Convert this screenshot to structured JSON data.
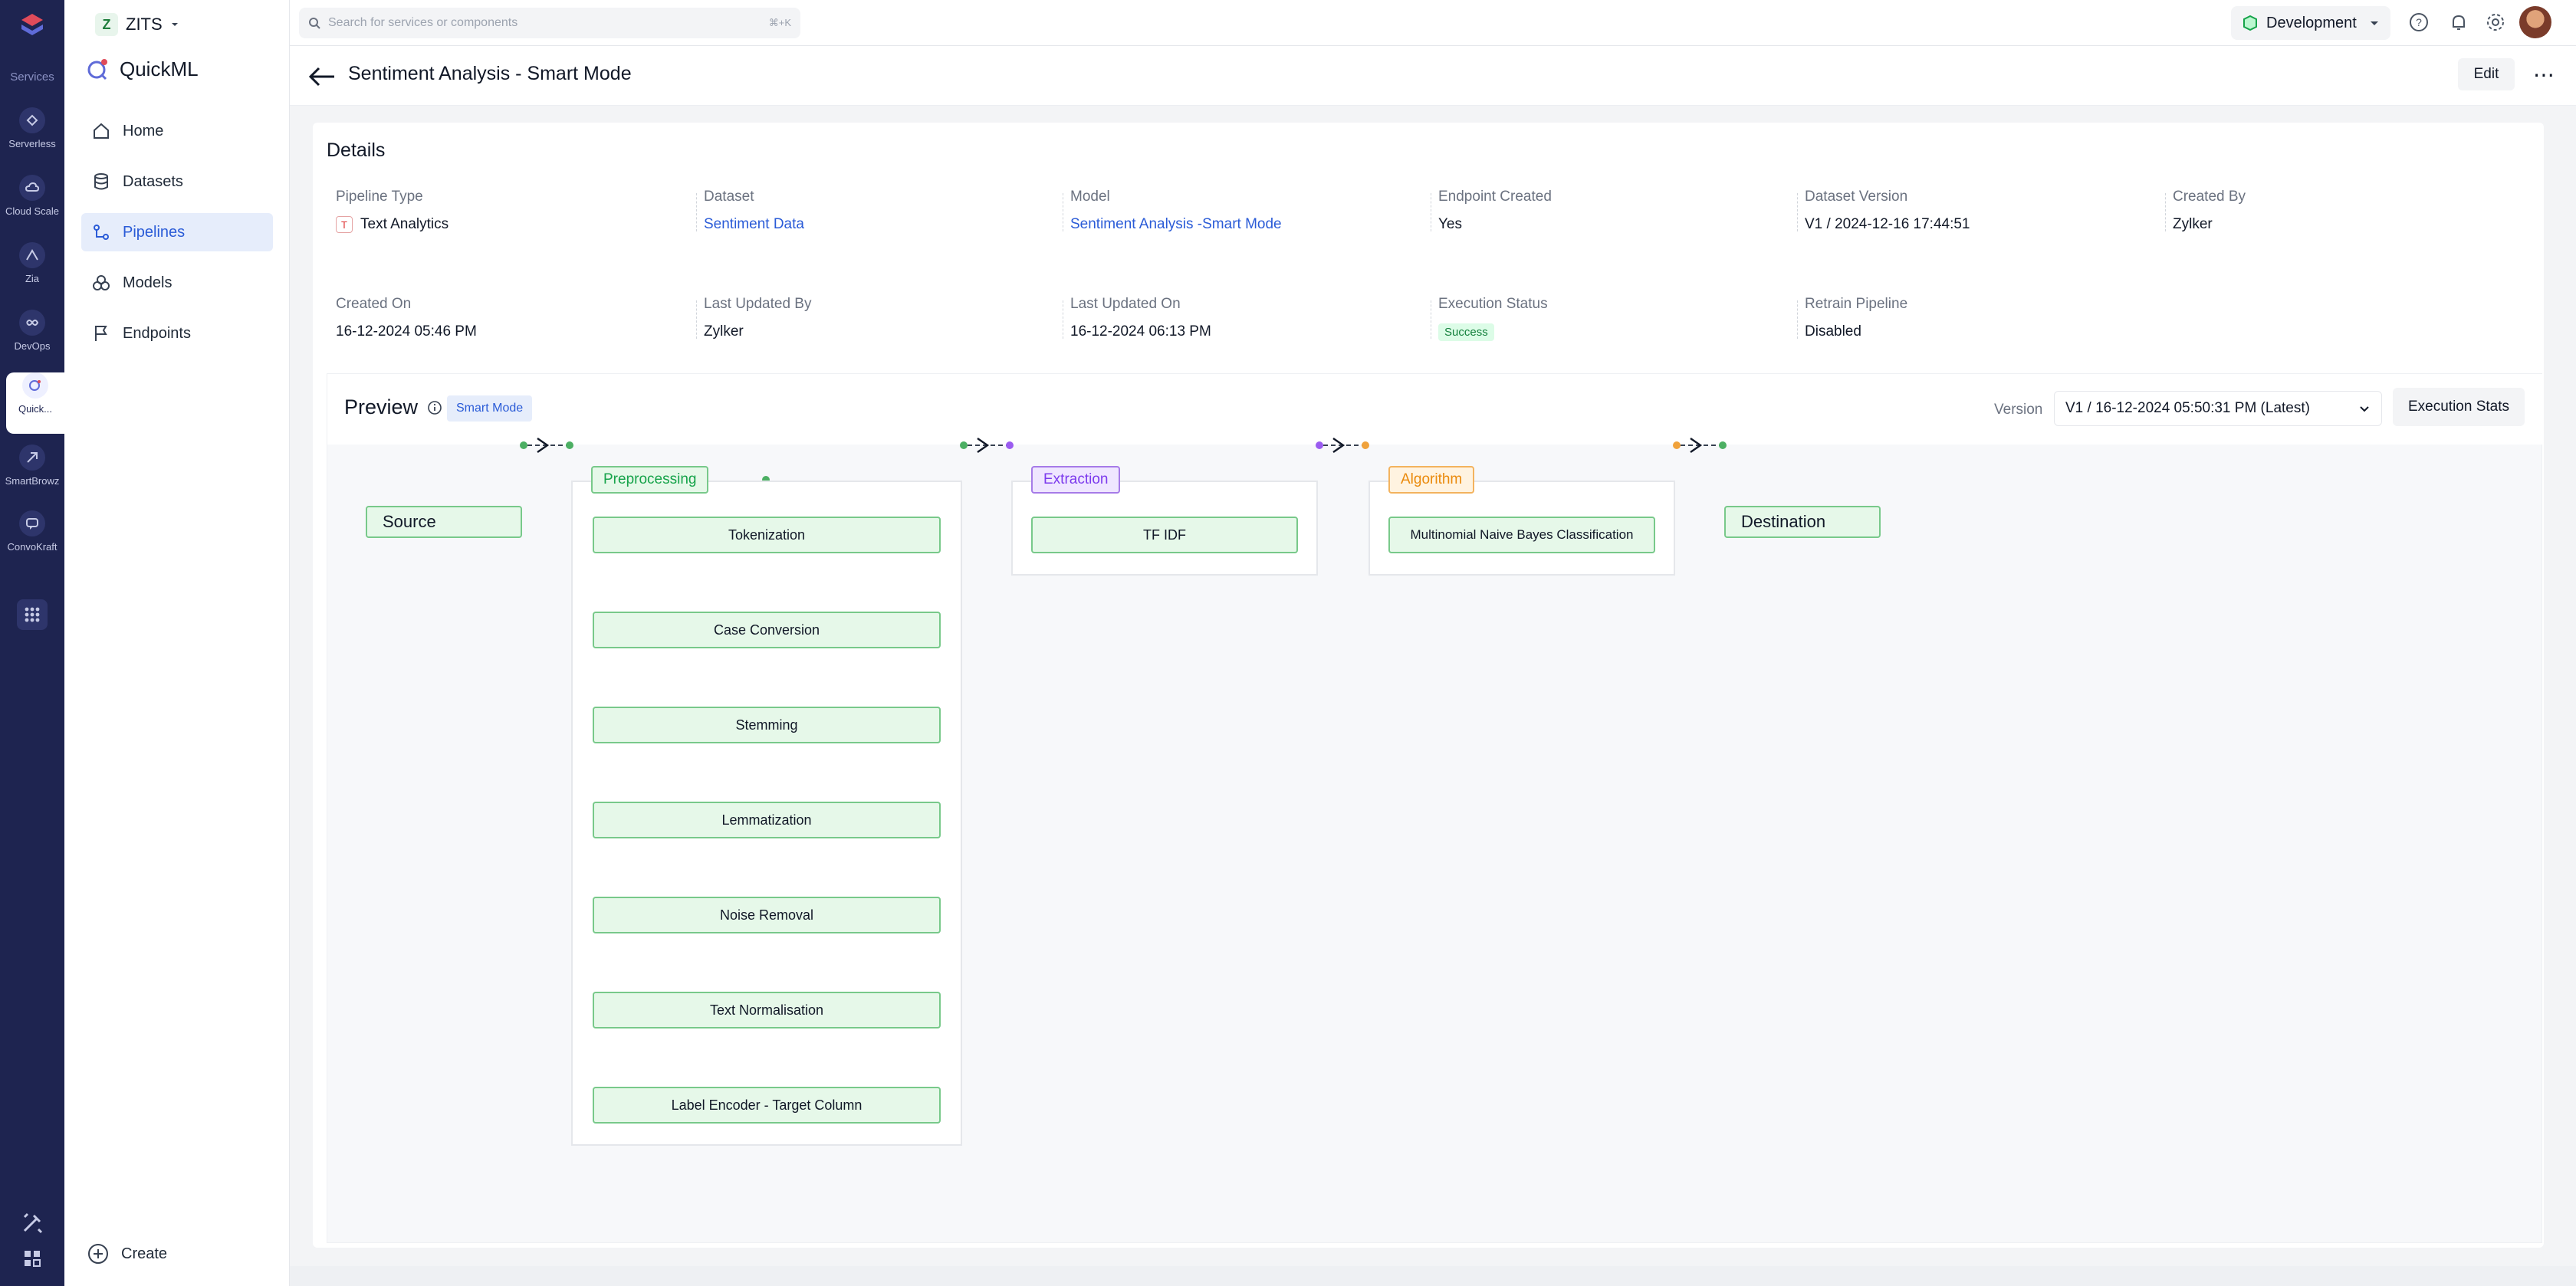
{
  "rail": {
    "services_label": "Services",
    "items": [
      {
        "label": "Serverless",
        "icon": "serverless-icon"
      },
      {
        "label": "Cloud Scale",
        "icon": "cloud-scale-icon"
      },
      {
        "label": "Zia",
        "icon": "zia-icon"
      },
      {
        "label": "DevOps",
        "icon": "devops-icon"
      },
      {
        "label": "Quick...",
        "icon": "quickml-icon",
        "active": true
      },
      {
        "label": "SmartBrowz",
        "icon": "smartbrowz-icon"
      },
      {
        "label": "ConvoKraft",
        "icon": "convokraft-icon"
      }
    ]
  },
  "workspace": {
    "initial": "Z",
    "name": "ZITS"
  },
  "app": {
    "name": "QuickML"
  },
  "nav": {
    "items": [
      {
        "label": "Home",
        "icon": "home-icon"
      },
      {
        "label": "Datasets",
        "icon": "database-icon"
      },
      {
        "label": "Pipelines",
        "icon": "pipeline-icon",
        "active": true
      },
      {
        "label": "Models",
        "icon": "models-icon"
      },
      {
        "label": "Endpoints",
        "icon": "flag-icon"
      }
    ],
    "create_label": "Create"
  },
  "topbar": {
    "search_placeholder": "Search for services or components",
    "search_shortcut": "⌘+K",
    "environment": "Development"
  },
  "header": {
    "title": "Sentiment Analysis - Smart Mode",
    "edit_label": "Edit",
    "more_label": "⋯"
  },
  "details": {
    "title": "Details",
    "fields": [
      {
        "label": "Pipeline Type",
        "value": "Text Analytics"
      },
      {
        "label": "Dataset",
        "value": "Sentiment Data"
      },
      {
        "label": "Model",
        "value": "Sentiment Analysis -Smart Mode"
      },
      {
        "label": "Endpoint Created",
        "value": "Yes"
      },
      {
        "label": "Dataset Version",
        "value": "V1 / 2024-12-16 17:44:51"
      },
      {
        "label": "Created By",
        "value": "Zylker"
      },
      {
        "label": "Created On",
        "value": "16-12-2024 05:46 PM"
      },
      {
        "label": "Last Updated By",
        "value": "Zylker"
      },
      {
        "label": "Last Updated On",
        "value": "16-12-2024 06:13 PM"
      },
      {
        "label": "Execution Status",
        "value": "Success"
      },
      {
        "label": "Retrain Pipeline",
        "value": "Disabled"
      }
    ]
  },
  "preview": {
    "title": "Preview",
    "mode_badge": "Smart Mode",
    "version_label": "Version",
    "version_value": "V1 / 16-12-2024 05:50:31 PM (Latest)",
    "exec_stats_label": "Execution Stats"
  },
  "flow": {
    "source": "Source",
    "destination": "Destination",
    "preprocessing": {
      "tag": "Preprocessing",
      "steps": [
        "Tokenization",
        "Case Conversion",
        "Stemming",
        "Lemmatization",
        "Noise Removal",
        "Text Normalisation",
        "Label Encoder - Target Column"
      ]
    },
    "extraction": {
      "tag": "Extraction",
      "steps": [
        "TF IDF"
      ]
    },
    "algorithm": {
      "tag": "Algorithm",
      "steps": [
        "Multinomial Naive Bayes Classification"
      ]
    }
  },
  "colors": {
    "rail_bg": "#1e2450",
    "accent": "#2a5bd7",
    "node_green": "#78c98a",
    "extraction_purple": "#a67be8",
    "algorithm_orange": "#f3b35e"
  }
}
